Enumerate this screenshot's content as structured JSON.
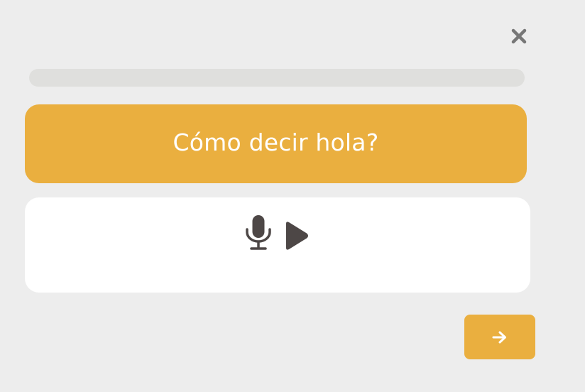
{
  "close_icon": "close-icon",
  "progress": {
    "value_percent": 0
  },
  "prompt": {
    "text": "Cómo decir hola?"
  },
  "answer": {
    "mic_icon": "microphone-icon",
    "play_icon": "play-icon"
  },
  "next_button": {
    "icon": "arrow-right-icon"
  },
  "colors": {
    "background": "#ededed",
    "accent": "#eaaf3f",
    "progress_track": "#dfdfdd",
    "card": "#ffffff",
    "icon_dark": "#4d4746",
    "close_icon": "#777777"
  }
}
